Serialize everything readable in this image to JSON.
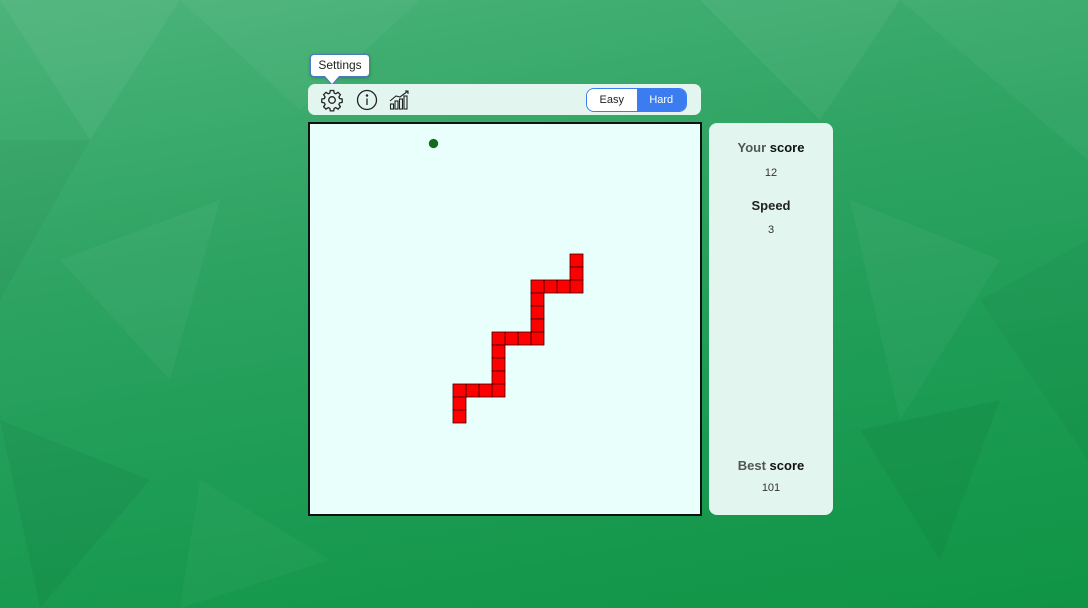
{
  "tooltip": {
    "text": "Settings"
  },
  "toolbar": {
    "icons": [
      "gear-icon",
      "info-icon",
      "chart-icon"
    ],
    "modes": [
      "Easy",
      "Hard"
    ],
    "selected_mode": "Hard",
    "accent_color": "#3b7cf0"
  },
  "board": {
    "grid_columns": 30,
    "grid_rows": 30,
    "food": {
      "col": 9,
      "row": 1,
      "color": "#136b1f"
    },
    "snake_color": "#ff0000",
    "snake": [
      [
        20,
        10
      ],
      [
        20,
        11
      ],
      [
        20,
        12
      ],
      [
        19,
        12
      ],
      [
        18,
        12
      ],
      [
        17,
        12
      ],
      [
        17,
        13
      ],
      [
        17,
        14
      ],
      [
        17,
        15
      ],
      [
        17,
        16
      ],
      [
        16,
        16
      ],
      [
        15,
        16
      ],
      [
        14,
        16
      ],
      [
        14,
        17
      ],
      [
        14,
        18
      ],
      [
        14,
        19
      ],
      [
        14,
        20
      ],
      [
        13,
        20
      ],
      [
        12,
        20
      ],
      [
        11,
        20
      ],
      [
        11,
        21
      ],
      [
        11,
        22
      ]
    ]
  },
  "panel": {
    "your_score": {
      "label_first": "Your",
      "label_second": "score",
      "value": "12"
    },
    "speed": {
      "label": "Speed",
      "value": "3"
    },
    "best_score": {
      "label_first": "Best",
      "label_second": "score",
      "value": "101"
    }
  }
}
